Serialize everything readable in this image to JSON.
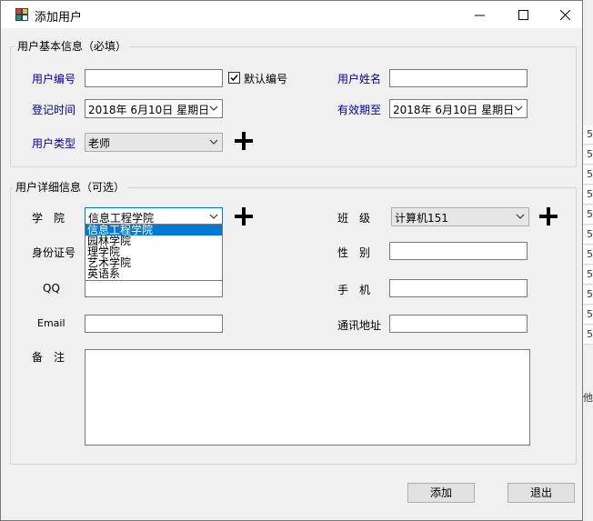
{
  "window": {
    "title": "添加用户"
  },
  "basic_group": {
    "legend": "用户基本信息（必填）",
    "user_id_label": "用户编号",
    "user_id_value": "",
    "default_id_label": "默认编号",
    "default_id_checked": true,
    "user_name_label": "用户姓名",
    "user_name_value": "",
    "register_label": "登记时间",
    "register_value": "2018年 6月10日 星期日",
    "valid_label": "有效期至",
    "valid_value": "2018年 6月10日 星期日",
    "type_label": "用户类型",
    "type_value": "老师"
  },
  "detail_group": {
    "legend": "用户详细信息（可选）",
    "college_label": "学　院",
    "college_value": "信息工程学院",
    "college_options": [
      "信息工程学院",
      "园林学院",
      "理学院",
      "艺术学院",
      "英语系"
    ],
    "class_label": "班　级",
    "class_value": "计算机151",
    "idcard_label": "身份证号",
    "gender_label": "性　别",
    "qq_label": "QQ",
    "phone_label": "手　机",
    "email_label": "Email",
    "address_label": "通讯地址",
    "remark_label": "备　注"
  },
  "buttons": {
    "add": "添加",
    "exit": "退出"
  },
  "background_strip": [
    "5",
    "5",
    "5",
    "5",
    "5",
    "5",
    "5",
    "5",
    "5",
    "5",
    "5"
  ],
  "background_strip_last": "他",
  "colors": {
    "label_blue": "#0000a8",
    "selection": "#0078d7"
  }
}
